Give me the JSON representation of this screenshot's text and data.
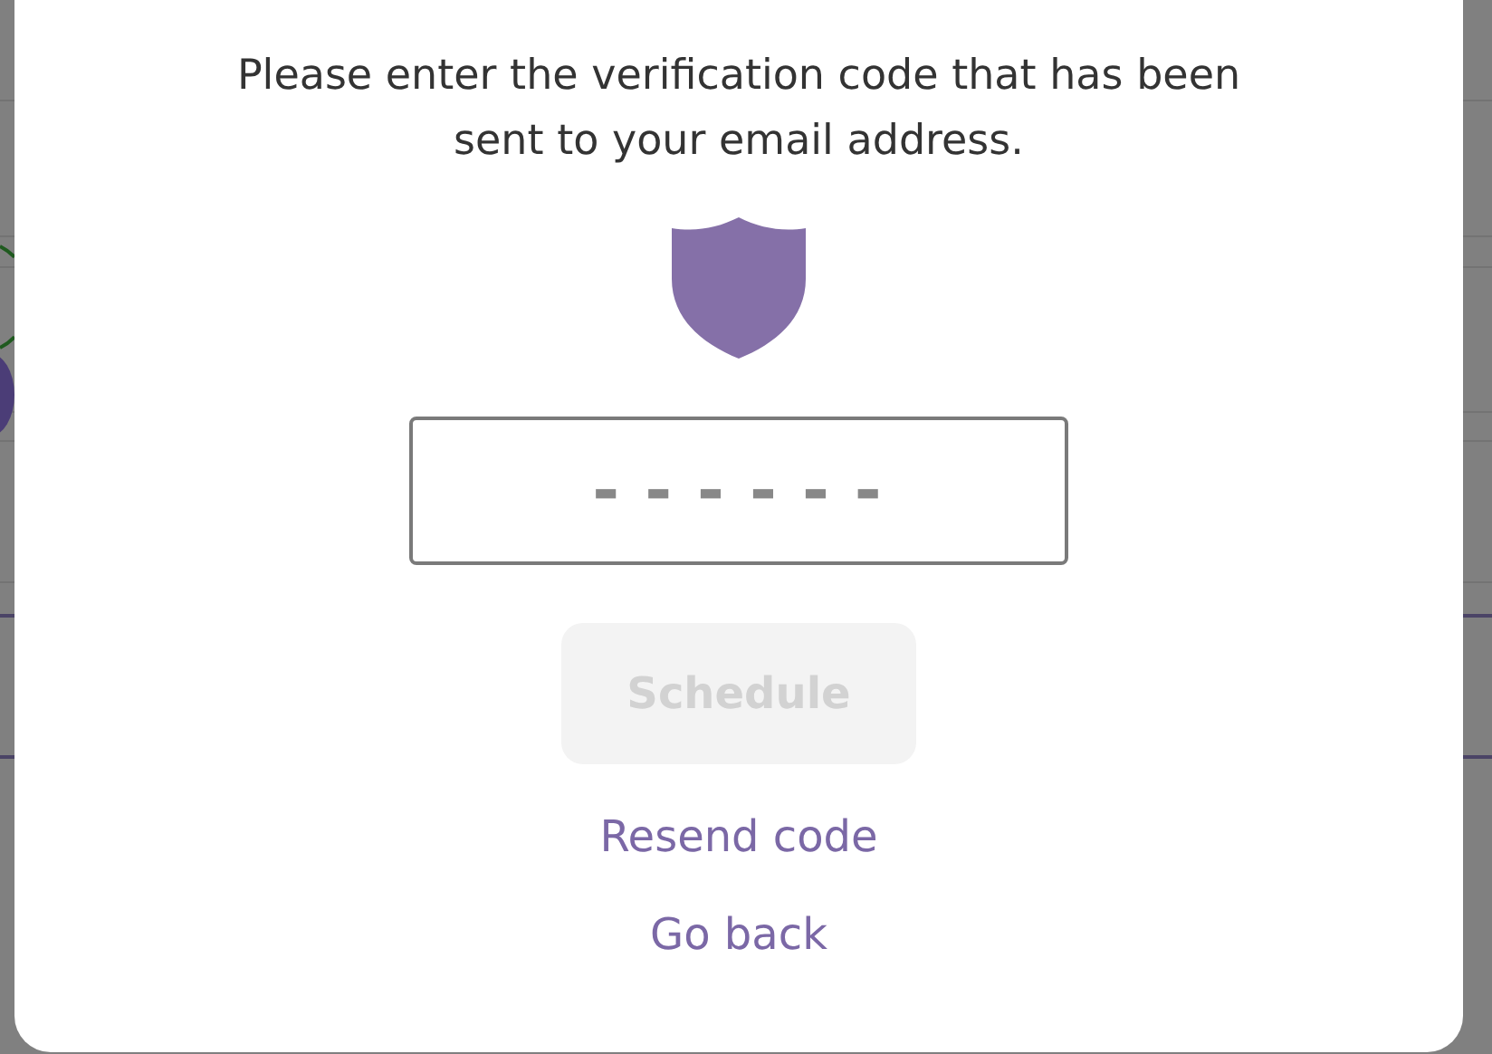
{
  "dialog": {
    "message": "Please enter the verification code that has been sent to your email address.",
    "code_field": {
      "placeholder": "------"
    },
    "submit_button": {
      "label": "Schedule",
      "disabled": true
    },
    "links": [
      {
        "label": "Resend code"
      },
      {
        "label": "Go back"
      }
    ]
  }
}
